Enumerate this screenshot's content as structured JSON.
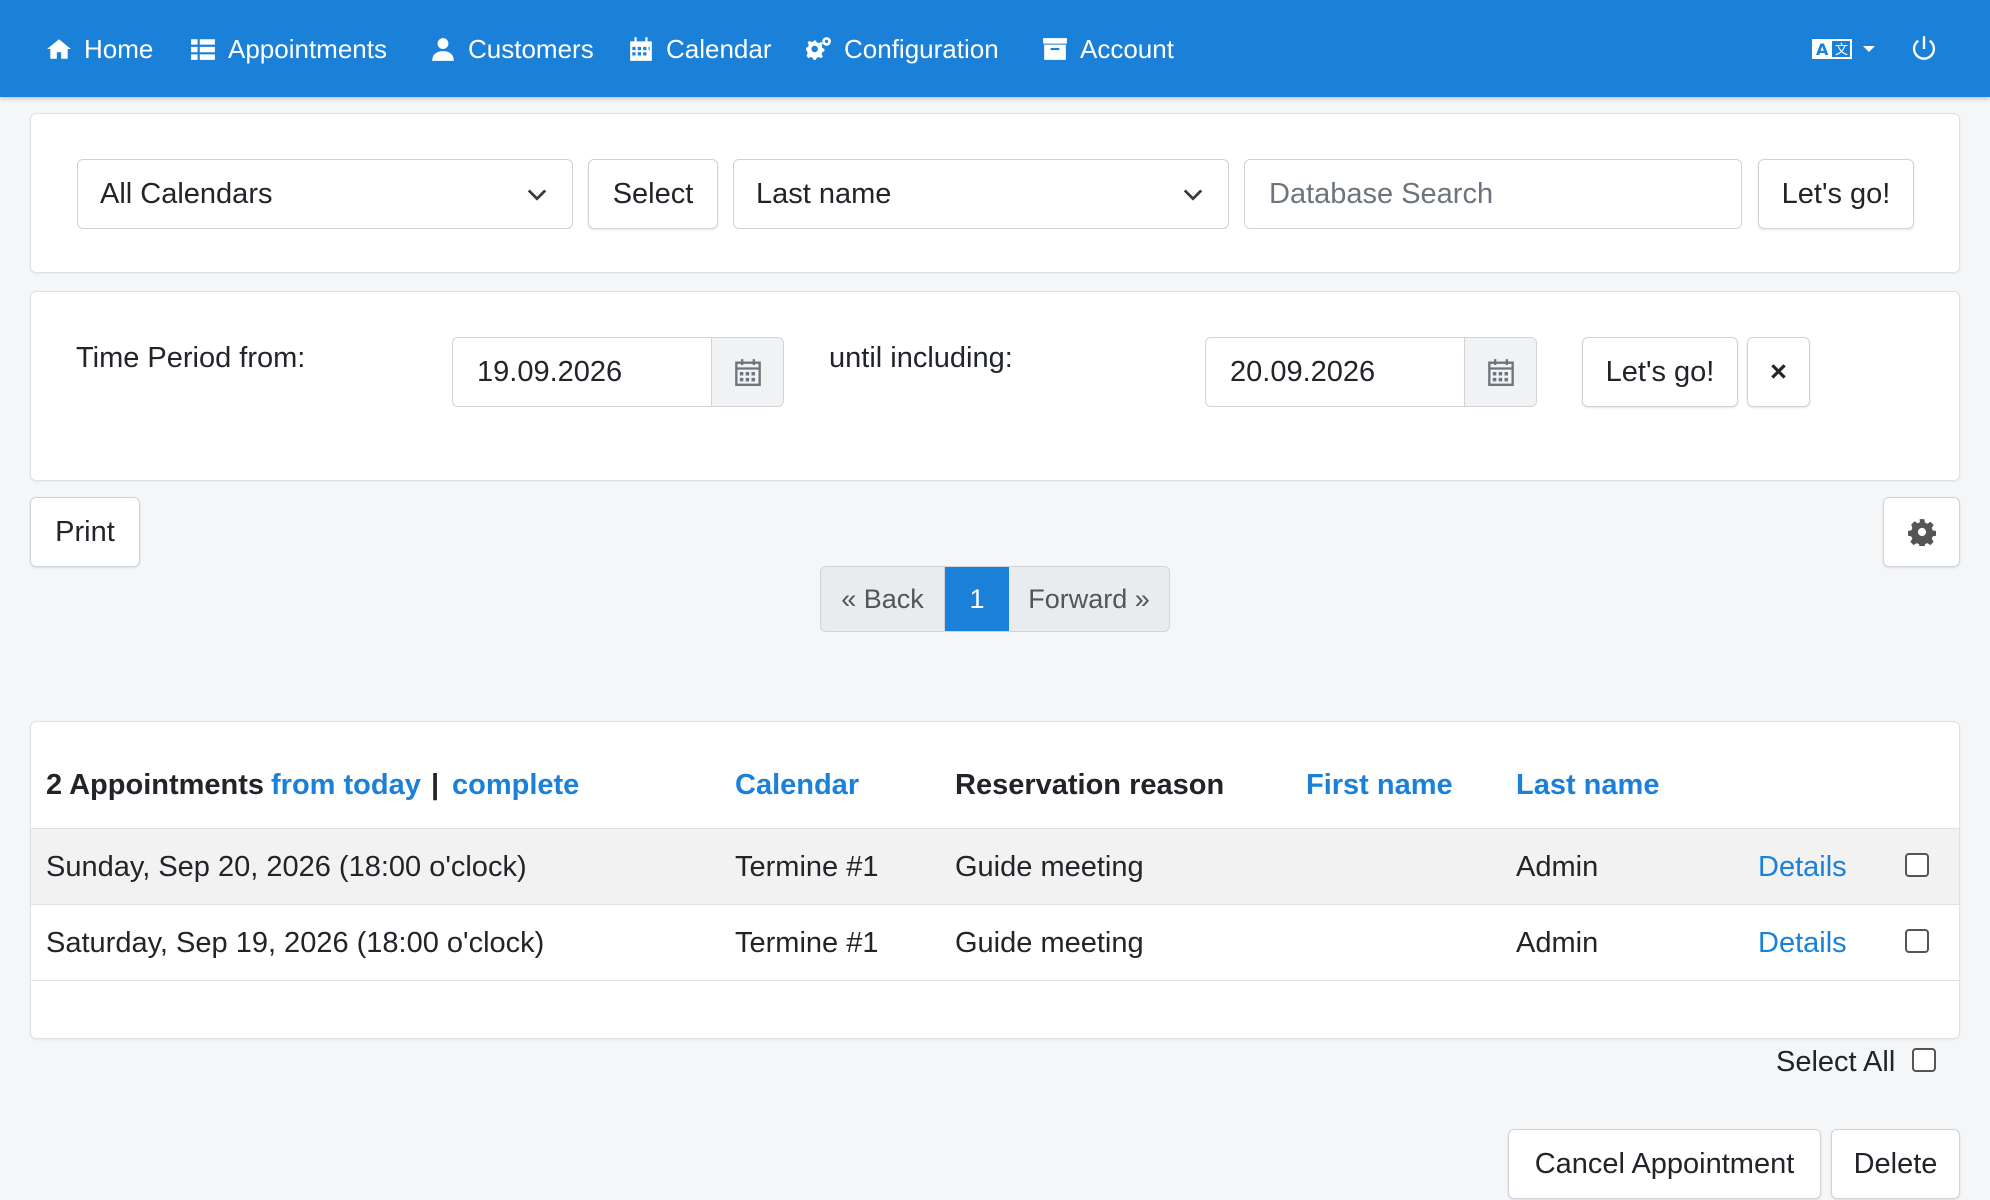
{
  "nav": {
    "home": "Home",
    "appointments": "Appointments",
    "customers": "Customers",
    "calendar": "Calendar",
    "configuration": "Configuration",
    "account": "Account"
  },
  "search": {
    "calendar_select": "All Calendars",
    "select_button": "Select",
    "field_select": "Last name",
    "db_search_placeholder": "Database Search",
    "go_button": "Let's go!"
  },
  "period": {
    "from_label": "Time Period from:",
    "from_value": "19.09.2026",
    "until_label": "until including:",
    "until_value": "20.09.2026",
    "go_button": "Let's go!",
    "clear_button": "×"
  },
  "toolbar": {
    "print_button": "Print"
  },
  "pagination": {
    "back": "« Back",
    "page": "1",
    "forward": "Forward »"
  },
  "table": {
    "count_label": "2 Appointments",
    "from_today": "from today",
    "separator": "|",
    "complete": "complete",
    "col_calendar": "Calendar",
    "col_reason": "Reservation reason",
    "col_first": "First name",
    "col_last": "Last name",
    "rows": [
      {
        "date": "Sunday, Sep 20, 2026 (18:00 o'clock)",
        "calendar": "Termine #1",
        "reason": "Guide meeting",
        "first": "",
        "last": "Admin",
        "details": "Details"
      },
      {
        "date": "Saturday, Sep 19, 2026 (18:00 o'clock)",
        "calendar": "Termine #1",
        "reason": "Guide meeting",
        "first": "",
        "last": "Admin",
        "details": "Details"
      }
    ]
  },
  "footer": {
    "select_all": "Select All",
    "cancel_button": "Cancel Appointment",
    "delete_button": "Delete"
  },
  "colors": {
    "primary": "#1b80d8",
    "background": "#f5f6f7"
  }
}
